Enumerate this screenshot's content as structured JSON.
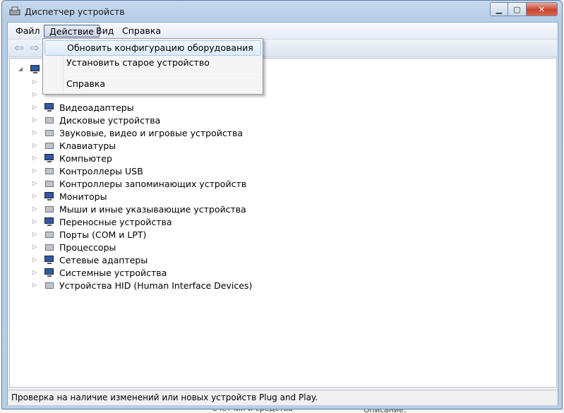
{
  "window": {
    "title": "Диспетчер устройств"
  },
  "menubar": {
    "items": [
      "Файл",
      "Действие",
      "Вид",
      "Справка"
    ]
  },
  "dropdown": {
    "items": [
      "Обновить конфигурацию оборудования",
      "Установить старое устройство",
      "Справка"
    ]
  },
  "tree": {
    "items": [
      "Видеоадаптеры",
      "Дисковые устройства",
      "Звуковые, видео и игровые устройства",
      "Клавиатуры",
      "Компьютер",
      "Контроллеры USB",
      "Контроллеры запоминающих устройств",
      "Мониторы",
      "Мыши и иные указывающие устройства",
      "Переносные устройства",
      "Порты (COM и LPT)",
      "Процессоры",
      "Сетевые адаптеры",
      "Системные устройства",
      "Устройства HID (Human Interface Devices)"
    ]
  },
  "statusbar": {
    "text": "Проверка на наличие изменений или новых устройств Plug and Play."
  },
  "background": {
    "bottom_left": "Счетчик и средства",
    "bottom_right": "Описание:"
  }
}
